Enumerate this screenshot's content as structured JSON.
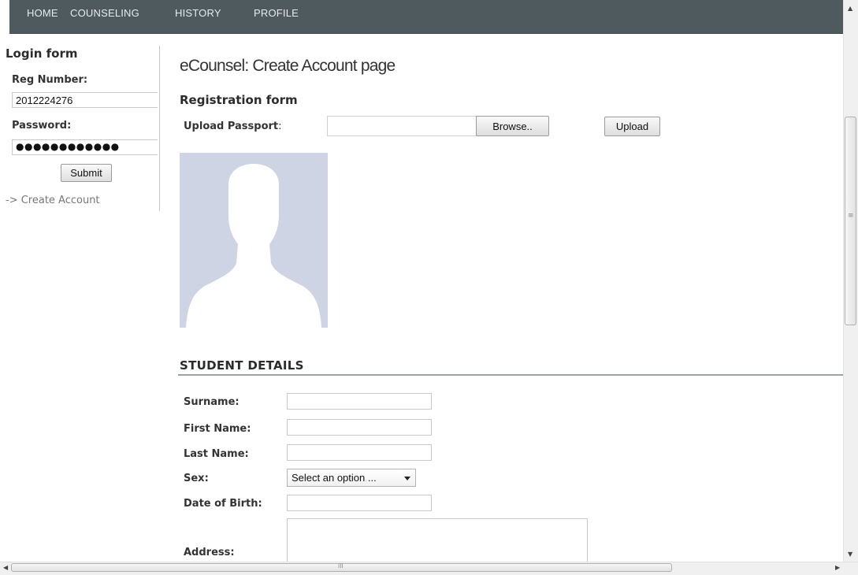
{
  "nav": {
    "items": [
      "HOME",
      "COUNSELING",
      "HISTORY",
      "PROFILE"
    ]
  },
  "login": {
    "title": "Login form",
    "reg_label": "Reg Number:",
    "reg_value": "2012224276",
    "password_label": "Password:",
    "password_value": "●●●●●●●●●●●●",
    "submit_label": "Submit",
    "create_account_link": "-> Create Account"
  },
  "page": {
    "heading": "eCounsel: Create Account page",
    "form_title": "Registration form",
    "upload_label": "Upload Passport",
    "upload_colon": ":",
    "browse_label": "Browse..",
    "upload_button": "Upload"
  },
  "student": {
    "section_title": "STUDENT DETAILS",
    "surname_label": "Surname:",
    "firstname_label": "First Name:",
    "lastname_label": "Last Name:",
    "sex_label": "Sex:",
    "sex_selected": "Select an option ...",
    "dob_label": "Date of Birth:",
    "address_label": "Address:"
  },
  "scrollbar": {
    "h_thumb_grip": "III",
    "v_thumb_grip": "≡"
  },
  "colors": {
    "navbar_bg": "#4f5a5e",
    "avatar_bg": "#ced4e3",
    "avatar_silhouette": "#ffffff"
  }
}
